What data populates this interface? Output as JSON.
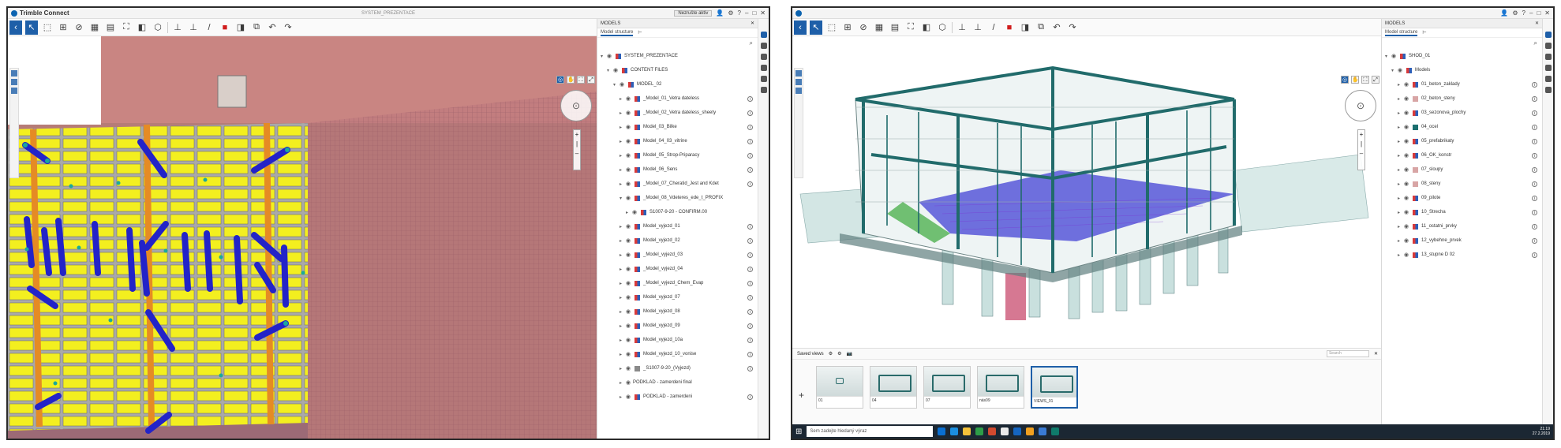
{
  "screenA": {
    "app_title": "Trimble Connect",
    "window_center_title": "SYSTEM_PREZENTACE",
    "panel": {
      "header": "MODELS",
      "tab_label": "Model structure",
      "tree": [
        {
          "level": 0,
          "label": "SYSTEM_PREZENTACE",
          "swatch": "rb",
          "expanded": true,
          "info": false
        },
        {
          "level": 1,
          "label": "CONTENT FILES",
          "swatch": "rb",
          "expanded": true,
          "info": false
        },
        {
          "level": 2,
          "label": "MODEL_02",
          "swatch": "rb",
          "expanded": true,
          "info": false
        },
        {
          "level": 3,
          "label": "_Model_01_Vetra dateless",
          "swatch": "rb",
          "info": true
        },
        {
          "level": 3,
          "label": "_Model_02_Vetra dateless_sheety",
          "swatch": "rb",
          "info": true
        },
        {
          "level": 3,
          "label": "Model_03_Bilke",
          "swatch": "rb",
          "info": true
        },
        {
          "level": 3,
          "label": "Model_04_03_vitrine",
          "swatch": "rb",
          "info": true
        },
        {
          "level": 3,
          "label": "Model_05_Strop-Priparacy",
          "swatch": "rb",
          "info": true
        },
        {
          "level": 3,
          "label": "Model_06_Sens",
          "swatch": "rb",
          "info": true
        },
        {
          "level": 3,
          "label": "_Model_07_Cheratid_Jest and Kdet",
          "swatch": "rb",
          "info": true
        },
        {
          "level": 3,
          "label": "_Model_08_Vdeteres_ede_t_PROFIX",
          "swatch": "rb",
          "expanded": true,
          "info": false
        },
        {
          "level": 4,
          "label": "S1007-9-20 - CONFIRM.00",
          "swatch": "rb",
          "info": false
        },
        {
          "level": 3,
          "label": "Model_vyjezd_01",
          "swatch": "rb",
          "info": true
        },
        {
          "level": 3,
          "label": "Model_vyjezd_02",
          "swatch": "rb",
          "info": true
        },
        {
          "level": 3,
          "label": "_Model_vyjezd_03",
          "swatch": "rb",
          "info": true
        },
        {
          "level": 3,
          "label": "_Model_vyjezd_04",
          "swatch": "rb",
          "info": true
        },
        {
          "level": 3,
          "label": "_Model_vyjezd_Chem_Evap",
          "swatch": "rb",
          "info": true
        },
        {
          "level": 3,
          "label": "Model_vyjezd_07",
          "swatch": "rb",
          "info": true
        },
        {
          "level": 3,
          "label": "Model_vyjezd_08",
          "swatch": "rb",
          "info": true
        },
        {
          "level": 3,
          "label": "Model_vyjezd_09",
          "swatch": "rb",
          "info": true
        },
        {
          "level": 3,
          "label": "Model_vyjezd_10a",
          "swatch": "rb",
          "info": true
        },
        {
          "level": 3,
          "label": "Model_vyjezd_10_vonise",
          "swatch": "rb",
          "info": true
        },
        {
          "level": 3,
          "label": "_S1007-9-20_(Vyjezd)",
          "swatch": "grey",
          "info": true
        },
        {
          "level": 3,
          "label": "PODKLAD - zamerdeni final",
          "swatch": "none",
          "info": false
        },
        {
          "level": 3,
          "label": "PODKLAD - zamerdeni",
          "swatch": "rb",
          "info": true
        }
      ]
    }
  },
  "screenB": {
    "app_title": "",
    "panel": {
      "header": "MODELS",
      "tab_label": "Model structure",
      "tree": [
        {
          "level": 0,
          "label": "SHOD_01",
          "swatch": "rb",
          "expanded": true,
          "info": false
        },
        {
          "level": 1,
          "label": "Models",
          "swatch": "rb",
          "expanded": true,
          "info": false
        },
        {
          "level": 2,
          "label": "01_beton_zaklady",
          "swatch": "rb",
          "info": true
        },
        {
          "level": 2,
          "label": "02_beton_steny",
          "swatch": "pink",
          "info": true
        },
        {
          "level": 2,
          "label": "03_sezonova_plochy",
          "swatch": "rb",
          "info": true
        },
        {
          "level": 2,
          "label": "04_ocel",
          "swatch": "teal",
          "info": true
        },
        {
          "level": 2,
          "label": "05_prefabrikaty",
          "swatch": "rb",
          "info": true
        },
        {
          "level": 2,
          "label": "06_OK_konstr",
          "swatch": "rb",
          "info": true
        },
        {
          "level": 2,
          "label": "07_sloupy",
          "swatch": "pink",
          "info": true
        },
        {
          "level": 2,
          "label": "08_steny",
          "swatch": "pink",
          "info": true
        },
        {
          "level": 2,
          "label": "09_pilote",
          "swatch": "rb",
          "info": true
        },
        {
          "level": 2,
          "label": "10_Strecha",
          "swatch": "rb",
          "info": true
        },
        {
          "level": 2,
          "label": "11_ostatni_prvky",
          "swatch": "rb",
          "info": true
        },
        {
          "level": 2,
          "label": "12_vybehne_prvek",
          "swatch": "rb",
          "info": true
        },
        {
          "level": 2,
          "label": "13_stupne D 02",
          "swatch": "rb",
          "info": true
        }
      ]
    },
    "views": {
      "dropdown_label": "Saved views",
      "search_placeholder": "Search",
      "thumbnails": [
        {
          "label": "01",
          "active": false
        },
        {
          "label": "04",
          "active": false
        },
        {
          "label": "07",
          "active": false
        },
        {
          "label": "nás09",
          "active": false
        },
        {
          "label": "VIEWS_01",
          "active": true
        }
      ]
    },
    "taskbar": {
      "search_text": "Sem zadejte hledaný výraz",
      "time": "21:19",
      "date": "27.2.2019"
    }
  }
}
